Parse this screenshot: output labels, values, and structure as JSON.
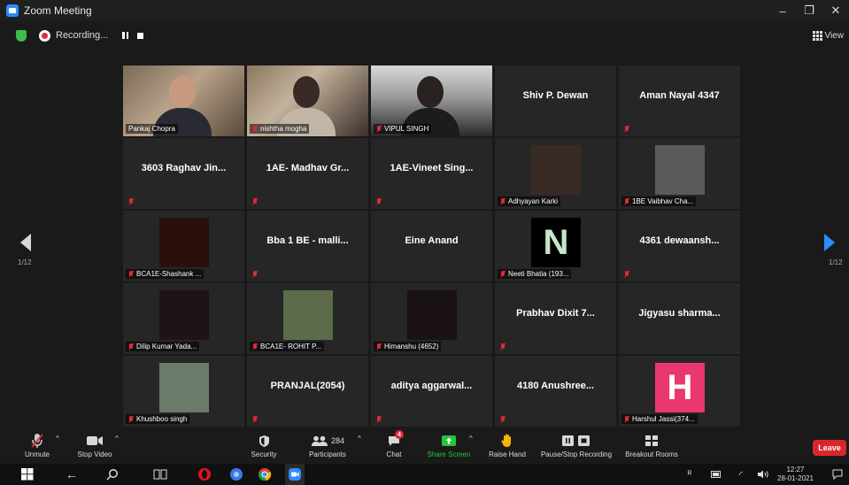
{
  "window": {
    "title": "Zoom Meeting",
    "controls": {
      "minimize": "–",
      "restore": "❐",
      "close": "✕"
    }
  },
  "recording": {
    "label": "Recording..."
  },
  "view_label": "View",
  "pagination": {
    "left": "1/12",
    "right": "1/12"
  },
  "tiles": [
    {
      "kind": "video",
      "label": "Pankaj Chopra",
      "muted": false,
      "active": true
    },
    {
      "kind": "video",
      "label": "nishtha mogha",
      "muted": true
    },
    {
      "kind": "video",
      "label": "VIPUL SINGH",
      "muted": true
    },
    {
      "kind": "name",
      "name": "Shiv P. Dewan",
      "muted": false
    },
    {
      "kind": "name",
      "name": "Aman Nayal 4347",
      "muted": true
    },
    {
      "kind": "name",
      "name": "3603 Raghav Jin...",
      "muted": true
    },
    {
      "kind": "name",
      "name": "1AE- Madhav Gr...",
      "muted": true
    },
    {
      "kind": "name",
      "name": "1AE-Vineet Sing...",
      "muted": true
    },
    {
      "kind": "thumb",
      "label": "Adhyayan Karki",
      "muted": true,
      "thumb_color": "#3a2a26"
    },
    {
      "kind": "thumb",
      "label": "1BE Vaibhav Cha...",
      "muted": true,
      "thumb_color": "#5a5a5a"
    },
    {
      "kind": "thumb",
      "label": "BCA1E-Shashank ...",
      "muted": true,
      "thumb_color": "#2b0f0a"
    },
    {
      "kind": "name",
      "name": "Bba 1 BE - malli...",
      "muted": true
    },
    {
      "kind": "name",
      "name": "Eine Anand",
      "muted": false
    },
    {
      "kind": "letter",
      "label": "Neeti Bhatia (193...",
      "muted": true,
      "letter": "N",
      "thumb_color": "#000000",
      "letter_color": "#c6e6c8"
    },
    {
      "kind": "name",
      "name": "4361 dewaansh...",
      "muted": true
    },
    {
      "kind": "thumb",
      "label": "Dilip Kumar Yada...",
      "muted": true,
      "thumb_color": "#1e1418"
    },
    {
      "kind": "thumb",
      "label": "BCA1E- ROHIT P...",
      "muted": true,
      "thumb_color": "#5c6b4a"
    },
    {
      "kind": "thumb",
      "label": "Himanshu (4652)",
      "muted": true,
      "thumb_color": "#1a1216"
    },
    {
      "kind": "name",
      "name": "Prabhav Dixit 7...",
      "muted": true
    },
    {
      "kind": "name",
      "name": "Jigyasu sharma...",
      "muted": false
    },
    {
      "kind": "thumb",
      "label": "Khushboo singh",
      "muted": true,
      "thumb_color": "#6b7a6a"
    },
    {
      "kind": "name",
      "name": "PRANJAL(2054)",
      "muted": true
    },
    {
      "kind": "name",
      "name": "aditya aggarwal...",
      "muted": true
    },
    {
      "kind": "name",
      "name": "4180 Anushree...",
      "muted": true
    },
    {
      "kind": "letter",
      "label": "Harshul Jassi(374...",
      "muted": true,
      "letter": "H",
      "thumb_color": "#e8386e",
      "letter_color": "#ffffff"
    }
  ],
  "toolbar": {
    "unmute": "Unmute",
    "stop_video": "Stop Video",
    "security": "Security",
    "participants": "Participants",
    "participants_count": "284",
    "chat": "Chat",
    "chat_badge": "4",
    "share_screen": "Share Screen",
    "raise_hand": "Raise Hand",
    "pause_recording": "Pause/Stop Recording",
    "breakout_rooms": "Breakout Rooms",
    "leave": "Leave"
  },
  "colors": {
    "accent": "#2d8cff",
    "share_green": "#25c43a",
    "leave_red": "#d9262d",
    "active_outline": "#c7e352"
  },
  "taskbar": {
    "time": "12:27",
    "date": "28-01-2021"
  }
}
